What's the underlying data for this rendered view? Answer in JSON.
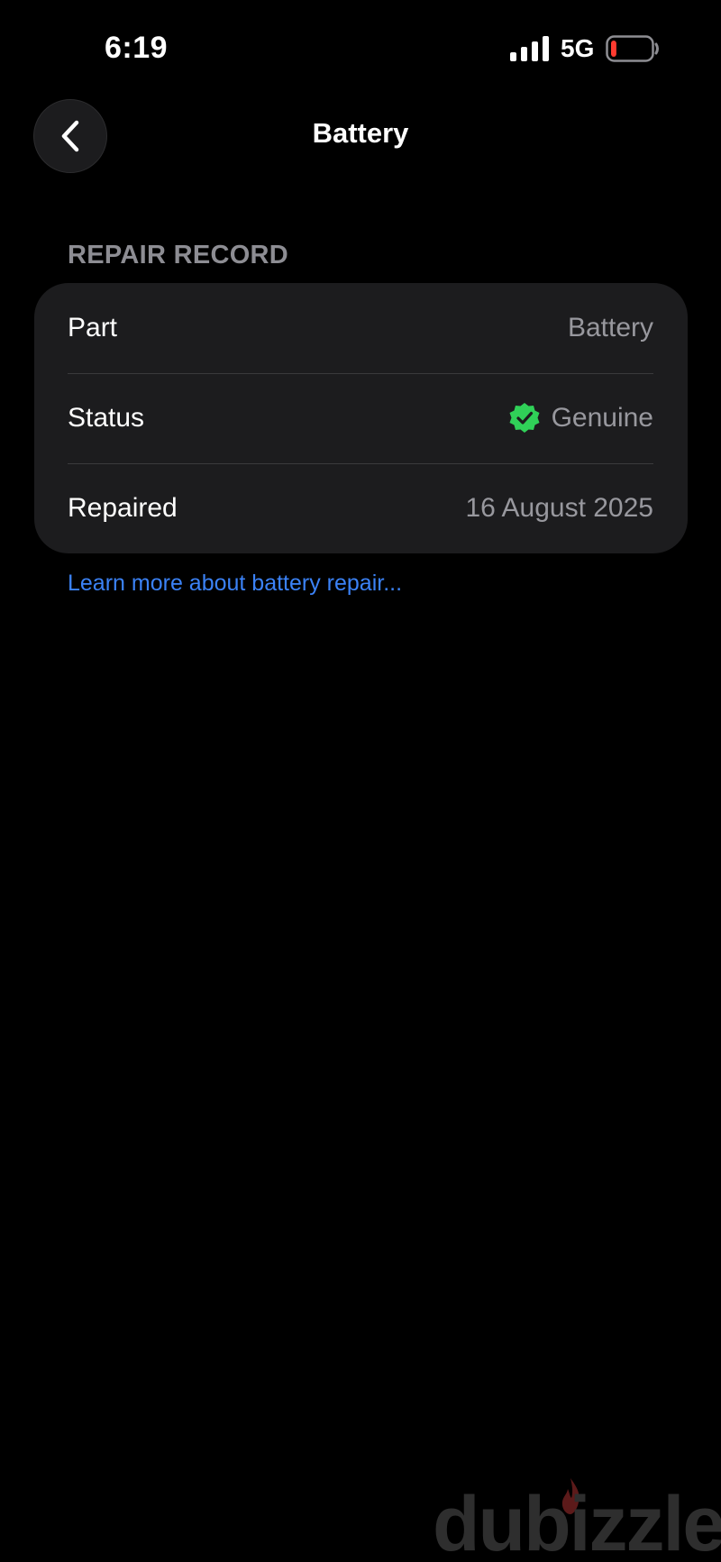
{
  "status_bar": {
    "time": "6:19",
    "network": "5G",
    "icons": {
      "signal": "cellular-signal-icon",
      "battery": "battery-low-icon"
    },
    "battery_level_percent": 10,
    "battery_color": "#ff3b30"
  },
  "nav": {
    "title": "Battery",
    "back_icon": "chevron-left-icon"
  },
  "section": {
    "header": "REPAIR RECORD",
    "rows": [
      {
        "label": "Part",
        "value": "Battery"
      },
      {
        "label": "Status",
        "value": "Genuine",
        "icon": "verified-check-icon",
        "icon_color": "#30d158"
      },
      {
        "label": "Repaired",
        "value": "16 August 2025"
      }
    ]
  },
  "link": {
    "text": "Learn more about battery repair..."
  },
  "watermark": {
    "text": "dubizzle",
    "flame_color": "#5c1a1a"
  },
  "colors": {
    "background": "#000000",
    "card": "#1c1c1e",
    "link": "#3b82f6",
    "secondary_text": "#98989e"
  }
}
